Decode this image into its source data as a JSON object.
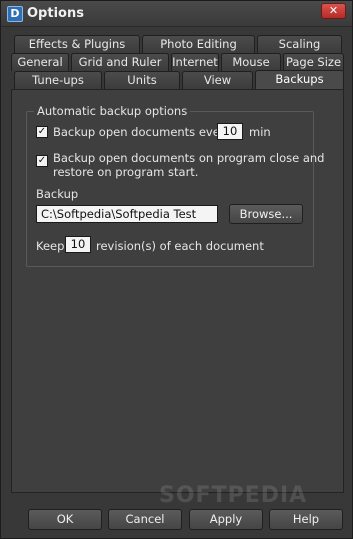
{
  "window": {
    "title": "Options",
    "app_icon_letter": "D",
    "close_label": "✕"
  },
  "tabs": {
    "row1": [
      "Effects & Plugins",
      "Photo Editing",
      "Scaling"
    ],
    "row2": [
      "General",
      "Grid and Ruler",
      "Internet",
      "Mouse",
      "Page Size"
    ],
    "row3": [
      "Tune-ups",
      "Units",
      "View",
      "Backups"
    ],
    "active": "Backups"
  },
  "backups": {
    "group_title": "Automatic backup options",
    "open_docs_label": "Backup open documents every",
    "open_docs_checked": true,
    "open_docs_interval": "10",
    "open_docs_unit": "min",
    "close_restore_label_line1": "Backup open documents on program close and",
    "close_restore_label_line2": "restore on program start.",
    "close_restore_checked": true,
    "backup_label": "Backup",
    "backup_path": "C:\\Softpedia\\Softpedia Test",
    "browse_label": "Browse...",
    "keep_label": "Keep",
    "keep_value": "10",
    "keep_suffix": "revision(s) of each document"
  },
  "footer": {
    "ok_label": "OK",
    "cancel_label": "Cancel",
    "apply_label": "Apply",
    "help_label": "Help"
  },
  "watermark": "SOFTPEDIA"
}
